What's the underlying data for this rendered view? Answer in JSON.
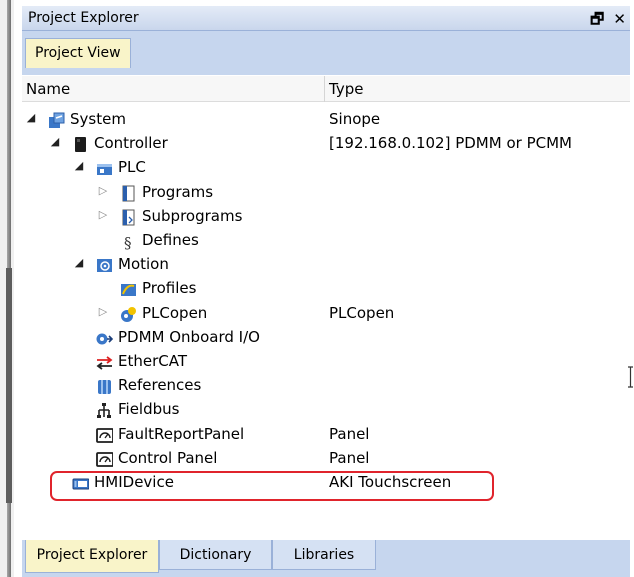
{
  "window": {
    "title": "Project Explorer",
    "buttons": [
      "🗗",
      "✕"
    ]
  },
  "top_tabs": [
    {
      "label": "Project View",
      "active": true
    }
  ],
  "columns": {
    "name": "Name",
    "type": "Type"
  },
  "tree": [
    {
      "label": "System",
      "type": "Sinope",
      "depth": 0,
      "toggle": "open",
      "icon": "system-icon"
    },
    {
      "label": "Controller",
      "type": "[192.168.0.102] PDMM or PCMM",
      "depth": 1,
      "toggle": "open",
      "icon": "controller-icon"
    },
    {
      "label": "PLC",
      "type": "",
      "depth": 2,
      "toggle": "open",
      "icon": "plc-icon"
    },
    {
      "label": "Programs",
      "type": "",
      "depth": 3,
      "toggle": "closed",
      "icon": "programs-icon"
    },
    {
      "label": "Subprograms",
      "type": "",
      "depth": 3,
      "toggle": "closed",
      "icon": "subprograms-icon"
    },
    {
      "label": "Defines",
      "type": "",
      "depth": 3,
      "toggle": "none",
      "icon": "defines-icon"
    },
    {
      "label": "Motion",
      "type": "",
      "depth": 2,
      "toggle": "open",
      "icon": "motion-icon"
    },
    {
      "label": "Profiles",
      "type": "",
      "depth": 3,
      "toggle": "none",
      "icon": "profiles-icon"
    },
    {
      "label": "PLCopen",
      "type": "PLCopen",
      "depth": 3,
      "toggle": "closed",
      "icon": "plcopen-icon"
    },
    {
      "label": "PDMM Onboard I/O",
      "type": "",
      "depth": 2,
      "toggle": "none",
      "icon": "onboard-io-icon"
    },
    {
      "label": "EtherCAT",
      "type": "",
      "depth": 2,
      "toggle": "none",
      "icon": "ethercat-icon"
    },
    {
      "label": "References",
      "type": "",
      "depth": 2,
      "toggle": "none",
      "icon": "references-icon"
    },
    {
      "label": "Fieldbus",
      "type": "",
      "depth": 2,
      "toggle": "none",
      "icon": "fieldbus-icon"
    },
    {
      "label": "FaultReportPanel",
      "type": "Panel",
      "depth": 2,
      "toggle": "none",
      "icon": "panel-icon"
    },
    {
      "label": "Control Panel",
      "type": "Panel",
      "depth": 2,
      "toggle": "none",
      "icon": "panel-icon"
    },
    {
      "label": "HMIDevice",
      "type": "AKI Touchscreen",
      "depth": 1,
      "toggle": "none",
      "icon": "hmi-device-icon"
    }
  ],
  "highlighted_item": "HMIDevice",
  "highlight_color": "#e0242c",
  "bottom_tabs": [
    {
      "label": "Project Explorer",
      "active": true
    },
    {
      "label": "Dictionary",
      "active": false
    },
    {
      "label": "Libraries",
      "active": false
    }
  ]
}
